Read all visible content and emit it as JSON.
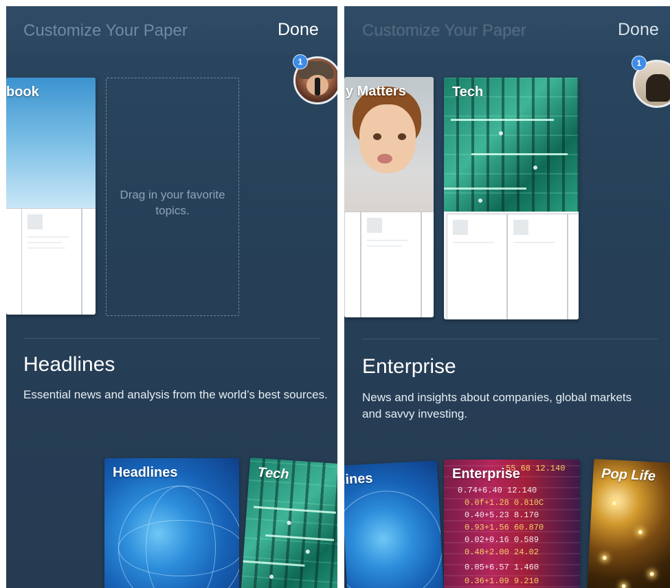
{
  "left": {
    "topbar": {
      "title": "Customize Your Paper",
      "done_label": "Done"
    },
    "avatar_badge": "1",
    "cards": {
      "partial_label": "book"
    },
    "placeholder_text": "Drag in your favorite topics.",
    "section": {
      "title": "Headlines",
      "description": "Essential news and analysis from the world’s best sources."
    },
    "sections_row": [
      {
        "label": "Headlines"
      },
      {
        "label": "Tech"
      }
    ]
  },
  "right": {
    "topbar": {
      "title": "Customize Your Paper",
      "done_label": "Done"
    },
    "avatar_badge": "1",
    "cards": [
      {
        "label": "y Matters"
      },
      {
        "label": "Tech"
      }
    ],
    "section": {
      "title": "Enterprise",
      "description": "News and insights about companies, global markets and savvy investing."
    },
    "sections_row": [
      {
        "label": "lines"
      },
      {
        "label": "Enterprise"
      },
      {
        "label": "Pop Life"
      }
    ],
    "ticker_rows": [
      "55 68 12.140",
      "0.74+6.40 12.140",
      "0.0f+1.28 0.810C",
      "0.40+5.23 8.170",
      "0.93+1.56 60.870",
      "0.02+0.16 0.589",
      "0.48+2.00 24.02",
      "0.05+6.57 1.460",
      "0.36+1.09 9.210"
    ]
  },
  "colors": {
    "accent_badge": "#3c8ce8",
    "panel_bg": "#263f57"
  }
}
